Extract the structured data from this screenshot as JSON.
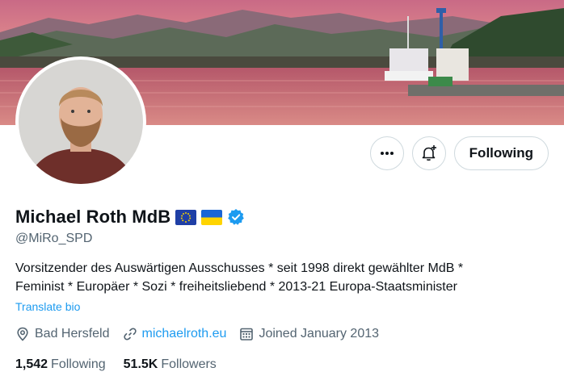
{
  "profile": {
    "name": "Michael Roth MdB",
    "handle": "@MiRo_SPD",
    "bio_lines": [
      "Vorsitzender des Auswärtigen Ausschusses * seit 1998 direkt gewählter MdB *",
      "Feminist * Europäer * Sozi * freiheitsliebend * 2013-21 Europa-Staatsminister"
    ],
    "translate_label": "Translate bio",
    "location": "Bad Hersfeld",
    "website": "michaelroth.eu",
    "joined": "Joined January 2013"
  },
  "actions": {
    "more_icon": "more-dots-icon",
    "notify_icon": "bell-plus-icon",
    "following_label": "Following"
  },
  "stats": {
    "following_count": "1,542",
    "following_label": "Following",
    "followers_count": "51.5K",
    "followers_label": "Followers"
  },
  "badges": [
    "eu-flag-icon",
    "ukraine-flag-icon",
    "verified-badge-icon"
  ],
  "colors": {
    "accent": "#1d9bf0",
    "secondary_text": "#536471",
    "primary_text": "#0f1419",
    "border": "#cfd9de"
  }
}
